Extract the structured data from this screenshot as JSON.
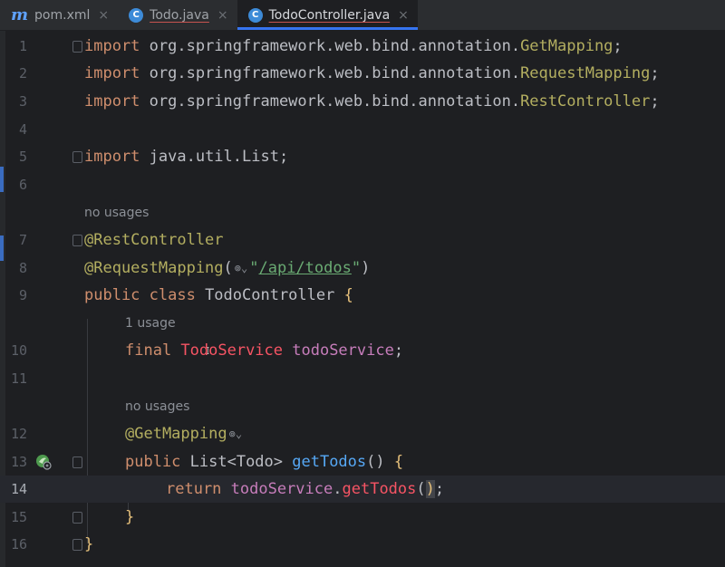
{
  "tabs": [
    {
      "icon": "m",
      "label": "pom.xml",
      "close": "×"
    },
    {
      "icon": "c",
      "label": "Todo.java",
      "close": "×"
    },
    {
      "icon": "c",
      "label": "TodoController.java",
      "close": "×"
    }
  ],
  "line_numbers": [
    "1",
    "2",
    "3",
    "4",
    "5",
    "6",
    "7",
    "8",
    "9",
    "10",
    "11",
    "12",
    "13",
    "14",
    "15",
    "16"
  ],
  "hints": {
    "no_usages_1": "no usages",
    "one_usage": "1 usage",
    "no_usages_2": "no usages"
  },
  "code": {
    "l1_kw": "import",
    "l1_pkg": " org.springframework.web.bind.annotation.",
    "l1_cls": "GetMapping",
    "l1_end": ";",
    "l2_kw": "import",
    "l2_pkg": " org.springframework.web.bind.annotation.",
    "l2_cls": "RequestMapping",
    "l2_end": ";",
    "l3_kw": "import",
    "l3_pkg": " org.springframework.web.bind.annotation.",
    "l3_cls": "RestController",
    "l3_end": ";",
    "l5_kw": "import",
    "l5_pkg": " java.util.List",
    "l5_end": ";",
    "l7_ann": "@RestController",
    "l8_ann": "@RequestMapping",
    "l8_open": "(",
    "l8_q1": "\"",
    "l8_path": "/api/todos",
    "l8_q2": "\"",
    "l8_close": ")",
    "l9_kw": "public class",
    "l9_name": " TodoController ",
    "l9_brace": "{",
    "l10_kw": "final",
    "l10_type": " TodoService",
    "l10_field": " todoService",
    "l10_end": ";",
    "l12_ann": "@GetMapping",
    "l13_kw": "public",
    "l13_type": " List<Todo> ",
    "l13_fn": "getTodos",
    "l13_parens": "()",
    "l13_brace": " {",
    "l14_kw": "return",
    "l14_field": " todoService",
    "l14_dot": ".",
    "l14_call": "getTodos",
    "l14_open": "(",
    "l14_close": ")",
    "l14_end": ";",
    "l15_brace": "}",
    "l16_brace": "}"
  },
  "colors": {
    "keyword": "#cf8e6d",
    "annotation": "#b3ae60",
    "string": "#6aab73",
    "field": "#c77dbb",
    "method": "#56a8f5",
    "error": "#f75464",
    "background": "#1e1f22",
    "active_tab_underline": "#3574f0"
  },
  "icons": {
    "tab_pom": "maven-icon",
    "tab_class": "java-class-icon",
    "endpoint": "endpoint-globe-icon",
    "run": "run-spring-endpoint-icon"
  }
}
